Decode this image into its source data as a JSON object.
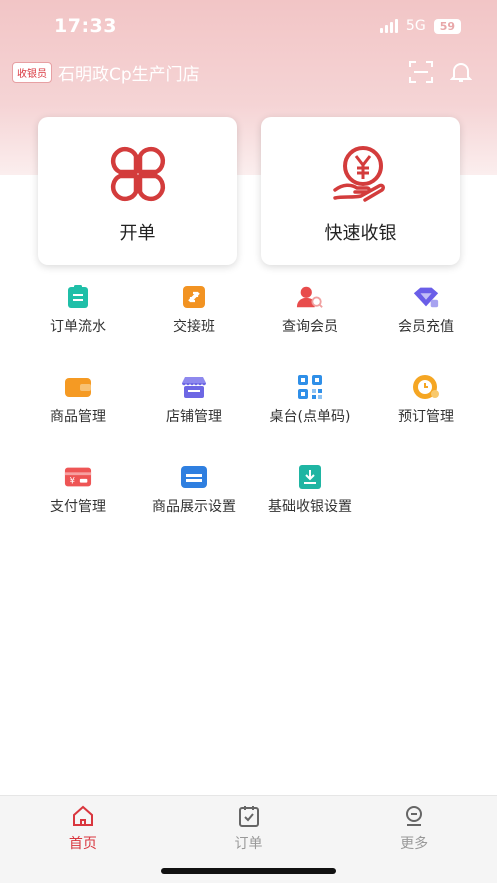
{
  "status_bar": {
    "time": "17:33",
    "network": "5G",
    "battery": "59"
  },
  "header": {
    "role_badge": "收银员",
    "store_name": "石明政Cp生产门店",
    "icons": [
      "scan-icon",
      "bell-icon"
    ]
  },
  "primary_actions": [
    {
      "label": "开单",
      "icon": "clover-order-icon"
    },
    {
      "label": "快速收银",
      "icon": "yen-cashier-icon"
    }
  ],
  "menu": [
    {
      "label": "订单流水",
      "icon": "clipboard-icon",
      "color": "#1fbfa8"
    },
    {
      "label": "交接班",
      "icon": "shift-swap-icon",
      "color": "#f29322"
    },
    {
      "label": "查询会员",
      "icon": "member-search-icon",
      "color": "#e84c4c"
    },
    {
      "label": "会员充值",
      "icon": "diamond-icon",
      "color": "#6a5ee8"
    },
    {
      "label": "商品管理",
      "icon": "wallet-icon",
      "color": "#f59a23"
    },
    {
      "label": "店铺管理",
      "icon": "store-icon",
      "color": "#6d67e4"
    },
    {
      "label": "桌台(点单码)",
      "icon": "qrcode-icon",
      "color": "#2f8fe8"
    },
    {
      "label": "预订管理",
      "icon": "reservation-clock-icon",
      "color": "#f5a623"
    },
    {
      "label": "支付管理",
      "icon": "payment-card-icon",
      "color": "#ee5555"
    },
    {
      "label": "商品展示设置",
      "icon": "display-card-icon",
      "color": "#2f7fe0"
    },
    {
      "label": "基础收银设置",
      "icon": "cashier-download-icon",
      "color": "#1fb5a3"
    }
  ],
  "tabbar": {
    "tabs": [
      {
        "label": "首页",
        "icon": "home-icon",
        "active": true
      },
      {
        "label": "订单",
        "icon": "order-check-icon",
        "active": false
      },
      {
        "label": "更多",
        "icon": "more-icon",
        "active": false
      }
    ],
    "active_color": "#d9363e",
    "inactive_color": "#999999"
  }
}
